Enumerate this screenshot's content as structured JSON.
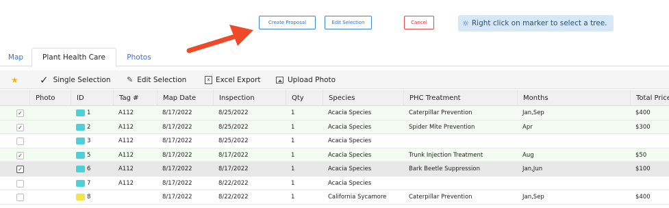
{
  "actions": {
    "create_proposal": "Create Proposal",
    "edit_selection": "Edit Selection",
    "cancel": "Cancel",
    "hint": "Right click on marker to select a tree.",
    "hint_icon": "lightbulb-icon"
  },
  "tabs": [
    {
      "label": "Map",
      "active": false
    },
    {
      "label": "Plant Health Care",
      "active": true
    },
    {
      "label": "Photos",
      "active": false
    }
  ],
  "toolbar": {
    "single_selection": "Single Selection",
    "edit_selection": "Edit Selection",
    "excel_export": "Excel Export",
    "upload_photo": "Upload Photo"
  },
  "table": {
    "columns": [
      "Photo",
      "ID",
      "Tag #",
      "Map Date",
      "Inspection",
      "Qty",
      "Species",
      "PHC Treatment",
      "Months",
      "Total Price"
    ],
    "rows": [
      {
        "checked": true,
        "color": "#4dd0d8",
        "id": "1",
        "tag": "A112",
        "map_date": "8/17/2022",
        "inspection": "8/25/2022",
        "qty": "1",
        "species": "Acacia Species",
        "treatment": "Caterpillar Prevention",
        "months": "Jan,Sep",
        "price": "$400"
      },
      {
        "checked": true,
        "color": "#4dd0d8",
        "id": "2",
        "tag": "A112",
        "map_date": "8/17/2022",
        "inspection": "8/25/2022",
        "qty": "1",
        "species": "Acacia Species",
        "treatment": "Spider Mite Prevention",
        "months": "Apr",
        "price": "$300"
      },
      {
        "checked": false,
        "color": "#4dd0d8",
        "id": "3",
        "tag": "A112",
        "map_date": "8/17/2022",
        "inspection": "8/25/2022",
        "qty": "1",
        "species": "Acacia Species",
        "treatment": "",
        "months": "",
        "price": ""
      },
      {
        "checked": true,
        "color": "#4dd0d8",
        "id": "5",
        "tag": "A112",
        "map_date": "8/17/2022",
        "inspection": "8/17/2022",
        "qty": "1",
        "species": "Acacia Species",
        "treatment": "Trunk Injection Treatment",
        "months": "Aug",
        "price": "$50"
      },
      {
        "checked": true,
        "color": "#4dd0d8",
        "id": "6",
        "tag": "A112",
        "map_date": "8/17/2022",
        "inspection": "8/17/2022",
        "qty": "1",
        "species": "Acacia Species",
        "treatment": "Bark Beetle Suppression",
        "months": "Jan,Jun",
        "price": "$100"
      },
      {
        "checked": false,
        "color": "#4dd0d8",
        "id": "7",
        "tag": "A112",
        "map_date": "8/17/2022",
        "inspection": "8/22/2022",
        "qty": "1",
        "species": "Acacia Species",
        "treatment": "",
        "months": "",
        "price": ""
      },
      {
        "checked": false,
        "color": "#f2e54a",
        "id": "8",
        "tag": "",
        "map_date": "8/17/2022",
        "inspection": "8/22/2022",
        "qty": "1",
        "species": "California Sycamore",
        "treatment": "Caterpillar Prevention",
        "months": "Jan,Sep",
        "price": "$400"
      }
    ]
  },
  "colors": {
    "accent_blue": "#3b83d4",
    "cancel_red": "#e0484a",
    "arrow_red": "#ee4a2a",
    "hint_bg": "#d6e8f7",
    "star": "#f3b400"
  }
}
